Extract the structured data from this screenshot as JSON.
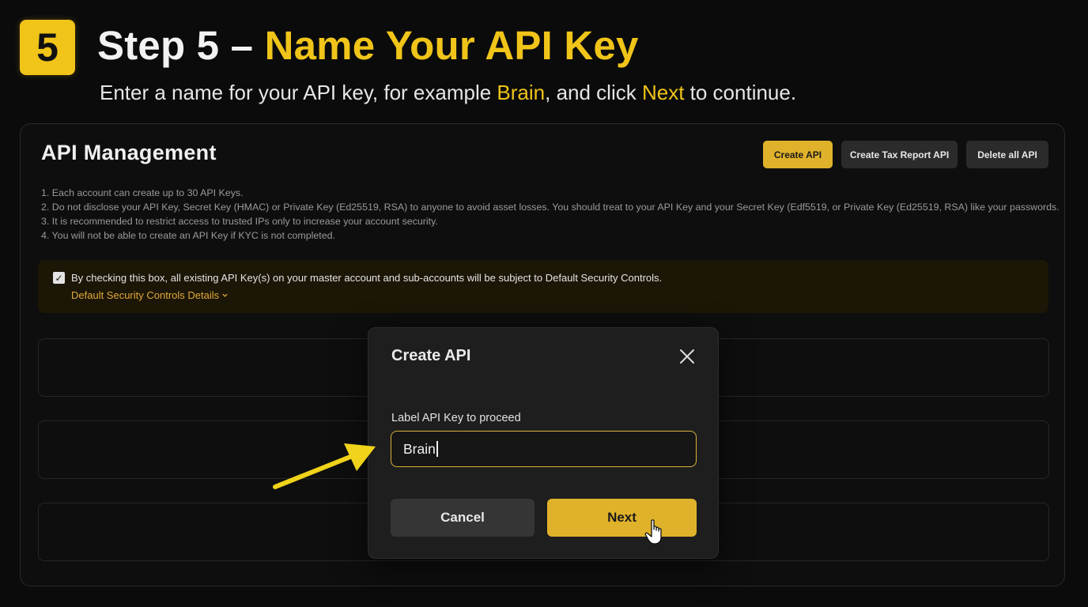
{
  "step": {
    "number": "5",
    "title_prefix": "Step 5 – ",
    "title_accent": "Name Your API Key",
    "subtitle_part1": "Enter a name for your API key, for example ",
    "subtitle_hl1": "Brain",
    "subtitle_part2": ", and click ",
    "subtitle_hl2": "Next",
    "subtitle_part3": " to continue."
  },
  "panel": {
    "title": "API Management",
    "buttons": {
      "create": "Create API",
      "tax": "Create Tax Report API",
      "delete": "Delete all API"
    },
    "notes": [
      "1. Each account can create up to 30 API Keys.",
      "2. Do not disclose your API Key, Secret Key (HMAC) or Private Key (Ed25519, RSA) to anyone to avoid asset losses. You should treat to your API Key and your Secret Key (Edf5519, or Private Key (Ed25519, RSA) like your passwords.",
      "3. It is recommended to restrict access to trusted IPs only to increase your account security.",
      "4. You will not be able to create an API Key if KYC is not completed."
    ],
    "security": {
      "checked": true,
      "text": "By checking this box, all existing API Key(s) on your master account and sub-accounts will be subject to Default Security Controls.",
      "link": "Default Security Controls Details"
    }
  },
  "modal": {
    "title": "Create API",
    "field_label": "Label API Key to proceed",
    "field_value": "Brain",
    "cancel": "Cancel",
    "next": "Next"
  },
  "colors": {
    "accent": "#f0c419",
    "button_yellow": "#e0b22b",
    "background": "#0b0b0b"
  },
  "icons": [
    "close-icon",
    "chevron-down-icon",
    "check-icon",
    "hand-cursor-icon",
    "pointer-arrow"
  ]
}
